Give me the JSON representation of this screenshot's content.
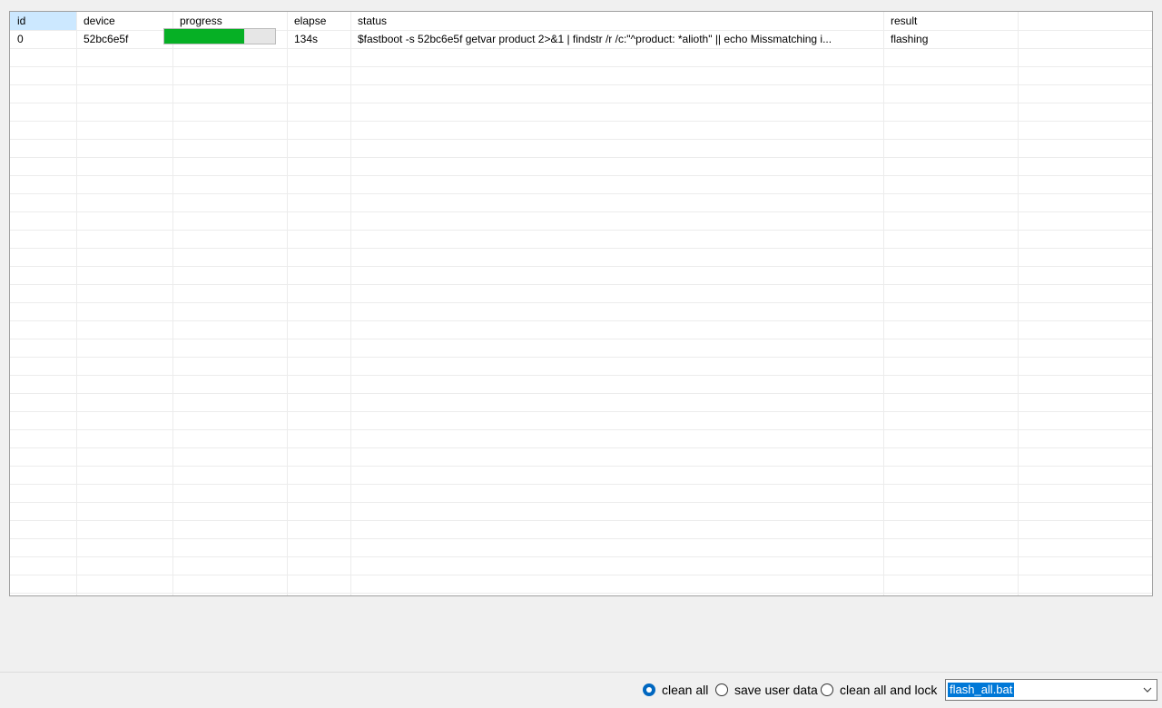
{
  "table": {
    "columns": [
      "id",
      "device",
      "progress",
      "elapse",
      "status",
      "result"
    ],
    "rows": [
      {
        "id": "0",
        "device": "52bc6e5f",
        "progress": 0.72,
        "elapse": "134s",
        "status": "$fastboot -s 52bc6e5f getvar product   2>&1  | findstr /r /c:\"^product: *alioth\"   || echo Missmatching i...",
        "result": "flashing"
      }
    ]
  },
  "options": {
    "clean_all": "clean all",
    "save_user_data": "save user data",
    "clean_all_and_lock": "clean all and lock",
    "selected": "clean_all"
  },
  "script_combo": {
    "value": "flash_all.bat"
  },
  "colors": {
    "progress_fill": "#06b025",
    "header_selected": "#cce8ff",
    "selection": "#0078d7",
    "radio_accent": "#0067c0"
  },
  "icons": {
    "combo_arrow": "chevron-down-icon"
  }
}
